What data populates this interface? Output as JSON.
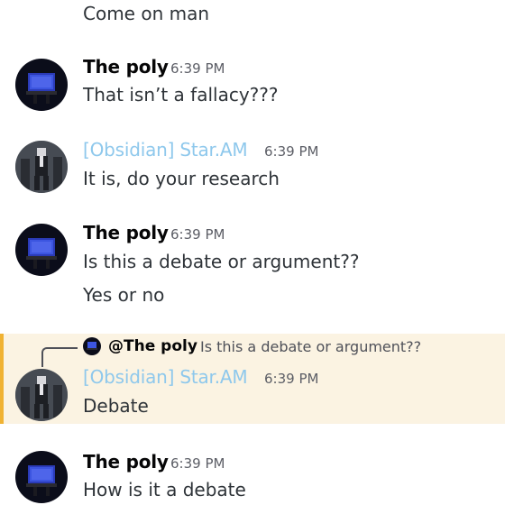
{
  "messages": [
    {
      "continuation": true,
      "text": "Come on man"
    },
    {
      "author": "The poly",
      "time": "6:39 PM",
      "text": "That isn’t a fallacy???"
    },
    {
      "author": "[Obsidian] Star.AM",
      "time": "6:39 PM",
      "text": "It is, do your research"
    },
    {
      "author": "The poly",
      "time": "6:39 PM",
      "text": "Is this a debate or argument??",
      "followup": "Yes or no"
    },
    {
      "author": "[Obsidian] Star.AM",
      "time": "6:39 PM",
      "text": "Debate",
      "reply": {
        "author": "@The poly",
        "text": "Is this a debate or argument??"
      },
      "highlighted": true
    },
    {
      "author": "The poly",
      "time": "6:39 PM",
      "text": "How is it a debate"
    }
  ],
  "colors": {
    "author_default": "#060607",
    "author_star": "#8ec8ec",
    "highlight_bg": "#fbf3e2",
    "highlight_bar": "#f0b232"
  },
  "icons": {
    "poly_avatar": "tv-screen-avatar-icon",
    "star_avatar": "suited-figure-avatar-icon"
  }
}
